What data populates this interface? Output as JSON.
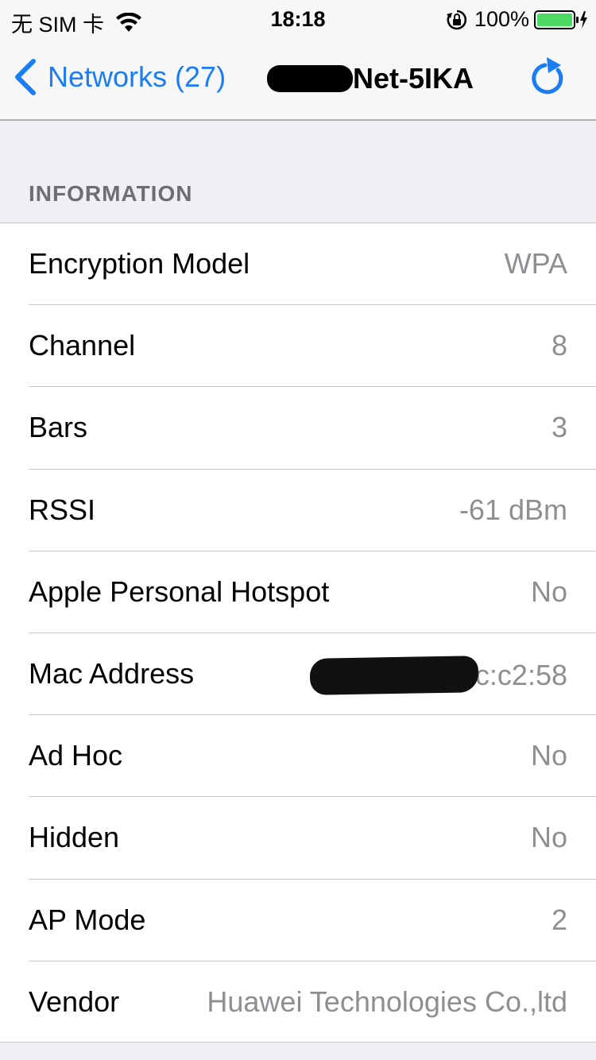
{
  "status_bar": {
    "carrier": "无 SIM 卡",
    "time": "18:18",
    "battery": "100%"
  },
  "nav": {
    "back_label": "Networks (27)",
    "title_suffix": "Net-5IKA"
  },
  "section": {
    "header": "INFORMATION"
  },
  "rows": [
    {
      "label": "Encryption Model",
      "value": "WPA"
    },
    {
      "label": "Channel",
      "value": "8"
    },
    {
      "label": "Bars",
      "value": "3"
    },
    {
      "label": "RSSI",
      "value": "-61 dBm"
    },
    {
      "label": "Apple Personal Hotspot",
      "value": "No"
    },
    {
      "label": "Mac Address",
      "value": "c:c2:58"
    },
    {
      "label": "Ad Hoc",
      "value": "No"
    },
    {
      "label": "Hidden",
      "value": "No"
    },
    {
      "label": "AP Mode",
      "value": "2"
    },
    {
      "label": "Vendor",
      "value": "Huawei Technologies Co.,ltd"
    }
  ],
  "colors": {
    "accent": "#1a7ef2",
    "battery": "#4cd964",
    "secondary_text": "#8e8e93",
    "background": "#efeff4"
  },
  "icons": [
    "wifi-icon",
    "orientation-lock-icon",
    "battery-icon",
    "charging-bolt-icon",
    "chevron-left-icon",
    "refresh-icon"
  ]
}
